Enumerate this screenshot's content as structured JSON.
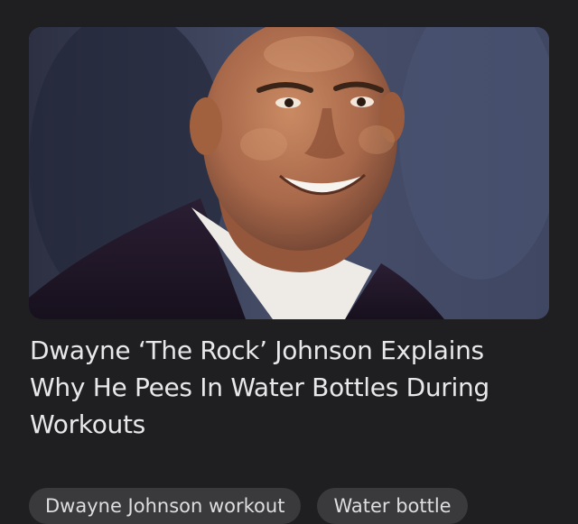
{
  "article": {
    "image_alt": "",
    "headline": "Dwayne ‘The Rock’ Johnson Explains Why He Pees In Water Bottles During Workouts"
  },
  "chips": [
    {
      "label": "Dwayne Johnson workout"
    },
    {
      "label": "Water bottle"
    }
  ],
  "colors": {
    "background": "#1f1f21",
    "headline_text": "#e8e8ea",
    "chip_background": "#3a3a3d",
    "chip_text": "#dedee0"
  }
}
